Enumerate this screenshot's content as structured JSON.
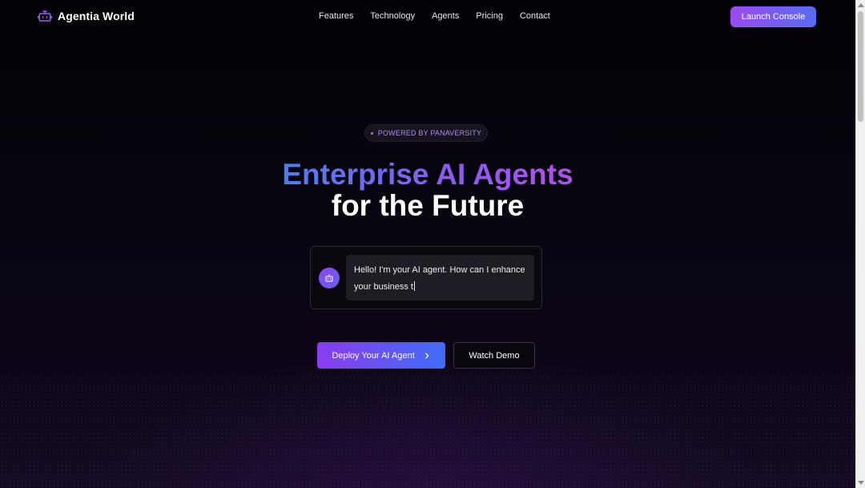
{
  "brand": {
    "name": "Agentia World",
    "icon": "robot-icon"
  },
  "nav": {
    "links": [
      "Features",
      "Technology",
      "Agents",
      "Pricing",
      "Contact"
    ],
    "cta_label": "Launch Console"
  },
  "hero": {
    "badge": "POWERED BY PANAVERSITY",
    "title_line1": "Enterprise AI Agents",
    "title_line2": "for the Future",
    "chat": {
      "avatar_icon": "robot-icon",
      "message": "Hello! I'm your AI agent. How can I enhance your business t"
    },
    "primary_button": "Deploy Your AI Agent",
    "secondary_button": "Watch Demo"
  },
  "colors": {
    "accent_purple": "#9b4cf0",
    "accent_blue": "#4c7cf0",
    "background": "#030206"
  }
}
